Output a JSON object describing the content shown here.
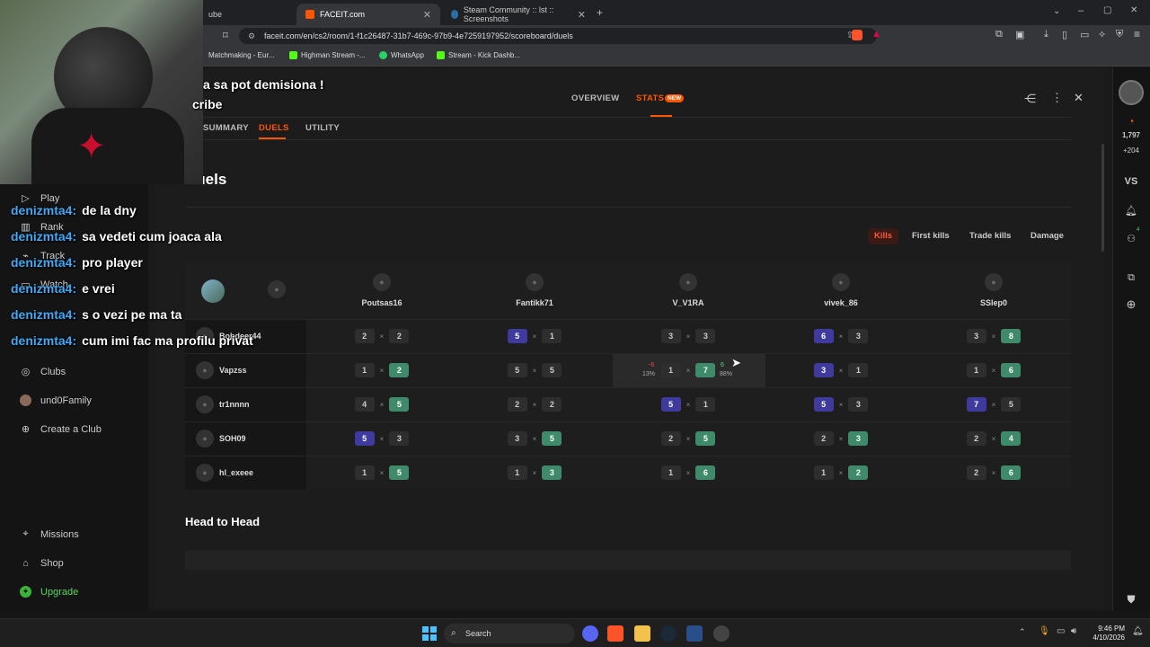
{
  "browser": {
    "tabs": [
      {
        "label": "ube"
      },
      {
        "label": "FACEIT.com"
      },
      {
        "label": "Steam Community :: lst :: Screenshots"
      }
    ],
    "url": "faceit.com/en/cs2/room/1-f1c26487-31b7-469c-97b9-4e7259197952/scoreboard/duels",
    "bookmarks": [
      "Matchmaking - Eur...",
      "Highman Stream -...",
      "WhatsApp",
      "Stream - Kick Dashb..."
    ]
  },
  "nav": {
    "items": [
      "Play",
      "Rank",
      "Track",
      "Watch",
      "Clubs",
      "und0Family",
      "Create a Club",
      "Missions",
      "Shop",
      "Upgrade"
    ]
  },
  "rightbar": {
    "elo": "1,797",
    "elo_delta": "+204",
    "vs": "VS",
    "badge": "4"
  },
  "header": {
    "tab_overview": "OVERVIEW",
    "tab_stats": "STATS",
    "new_badge": "NEW",
    "sub_summary": "SUMMARY",
    "sub_duels": "DUELS",
    "sub_utility": "UTILITY"
  },
  "duels": {
    "title": "Duels",
    "filters": [
      "Kills",
      "First kills",
      "Trade kills",
      "Damage"
    ],
    "columns": [
      "Poutsas16",
      "Fantikk71",
      "V_V1RA",
      "vivek_86",
      "SSlep0"
    ],
    "rows": [
      {
        "name": "Bobdeer44",
        "cells": [
          [
            2,
            2
          ],
          [
            5,
            1
          ],
          [
            3,
            3
          ],
          [
            6,
            3
          ],
          [
            3,
            8
          ]
        ]
      },
      {
        "name": "Vapzss",
        "cells": [
          [
            1,
            2
          ],
          [
            5,
            5
          ],
          [
            1,
            7
          ],
          [
            3,
            1
          ],
          [
            1,
            6
          ]
        ]
      },
      {
        "name": "tr1nnnn",
        "cells": [
          [
            4,
            5
          ],
          [
            2,
            2
          ],
          [
            5,
            1
          ],
          [
            5,
            3
          ],
          [
            7,
            5
          ]
        ]
      },
      {
        "name": "SOH09",
        "cells": [
          [
            5,
            3
          ],
          [
            3,
            5
          ],
          [
            2,
            5
          ],
          [
            2,
            3
          ],
          [
            2,
            4
          ]
        ]
      },
      {
        "name": "hl_exeee",
        "cells": [
          [
            1,
            5
          ],
          [
            1,
            3
          ],
          [
            1,
            6
          ],
          [
            1,
            2
          ],
          [
            2,
            6
          ]
        ]
      }
    ],
    "hover": {
      "left_delta": "-6",
      "left_pct": "13%",
      "right_delta": "6",
      "right_pct": "88%"
    }
  },
  "head_to_head": {
    "title": "Head to Head"
  },
  "chat": {
    "overlay_top1": "a sa pot demisiona !",
    "overlay_top2": "cribe",
    "lines": [
      {
        "user": "denizmta4:",
        "msg": "de la dny"
      },
      {
        "user": "denizmta4:",
        "msg": "sa vedeti cum joaca ala"
      },
      {
        "user": "denizmta4:",
        "msg": "pro player"
      },
      {
        "user": "denizmta4:",
        "msg": "e vrei"
      },
      {
        "user": "denizmta4:",
        "msg": "s o vezi pe ma ta"
      },
      {
        "user": "denizmta4:",
        "msg": "cum imi fac ma profilu privat"
      }
    ]
  },
  "taskbar": {
    "search": "Search",
    "time": "9:46 PM",
    "date": "4/10/2026"
  },
  "colors": {
    "accent": "#ff5500",
    "win_left": "#3f3a9e",
    "win_right": "#3e8a6a",
    "chat_user": "#3fa9f5"
  }
}
